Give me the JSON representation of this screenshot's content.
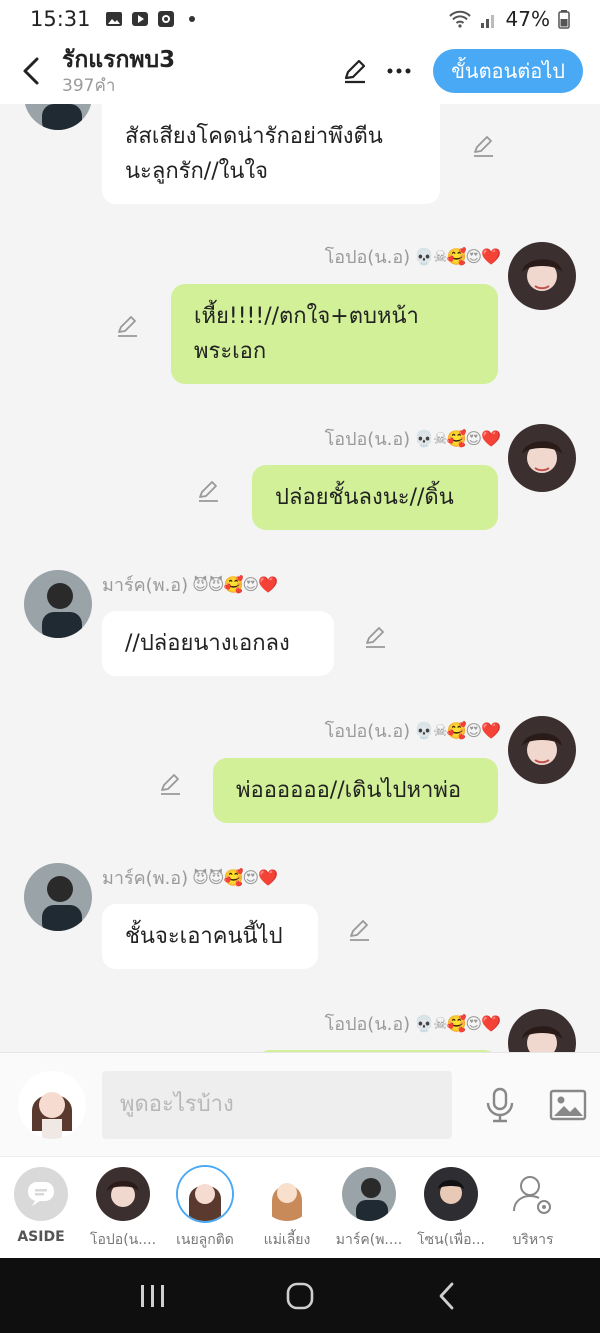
{
  "status_bar": {
    "time": "15:31",
    "battery": "47%",
    "icons": [
      "gallery-icon",
      "play-icon",
      "record-icon",
      "dot-icon",
      "wifi-icon",
      "signal-icon",
      "battery-icon"
    ]
  },
  "header": {
    "title": "รักแรกพบ3",
    "subtitle": "397คำ",
    "next_button": "ขั้นตอนต่อไป"
  },
  "messages": [
    {
      "side": "left",
      "text_lines": [
        "สัสเสียงโคดน่ารักอย่าพึงตีน",
        "นะลูกรัก//ในใจ"
      ],
      "sender": "",
      "emojis": ""
    },
    {
      "side": "right",
      "sender": "โอปอ(น.อ)",
      "emojis": "💀☠🥰😍❤️",
      "text_lines": [
        "เหี้ย!!!!//ตกใจ+ตบหน้า",
        "พระเอก"
      ]
    },
    {
      "side": "right",
      "sender": "โอปอ(น.อ)",
      "emojis": "💀☠🥰😍❤️",
      "text_lines": [
        "ปล่อยชั้นลงนะ//ดิ้น"
      ]
    },
    {
      "side": "left",
      "sender": "มาร์ค(พ.อ)",
      "emojis": "😈😈🥰😍❤️",
      "text_lines": [
        "//ปล่อยนางเอกลง"
      ]
    },
    {
      "side": "right",
      "sender": "โอปอ(น.อ)",
      "emojis": "💀☠🥰😍❤️",
      "text_lines": [
        "พ่ออออออ//เดินไปหาพ่อ"
      ]
    },
    {
      "side": "left",
      "sender": "มาร์ค(พ.อ)",
      "emojis": "😈😈🥰😍❤️",
      "text_lines": [
        "ชั้นจะเอาคนนี้ไป"
      ]
    },
    {
      "side": "right",
      "sender": "โอปอ(น.อ)",
      "emojis": "💀☠🥰😍❤️",
      "text_lines": []
    }
  ],
  "composer": {
    "placeholder": "พูดอะไรบ้าง"
  },
  "characters": [
    {
      "label": "ASIDE",
      "icon": "chat-bubble-icon"
    },
    {
      "label": "โอปอ(น....",
      "color": "#6b4b45"
    },
    {
      "label": "เนยลูกติด",
      "color": "#7a5a4c"
    },
    {
      "label": "แม่เลี้ยง",
      "color": "#c98a5a"
    },
    {
      "label": "มาร์ค(พ....",
      "color": "#4b5a66"
    },
    {
      "label": "โซน(เพื่อ...",
      "color": "#2e2e32"
    },
    {
      "label": "บริหาร",
      "icon": "person-gear-icon"
    }
  ],
  "colors": {
    "accent": "#4aa9f5",
    "bubble_right": "#d2f098",
    "bubble_left": "#ffffff",
    "background": "#f4f4f4"
  }
}
